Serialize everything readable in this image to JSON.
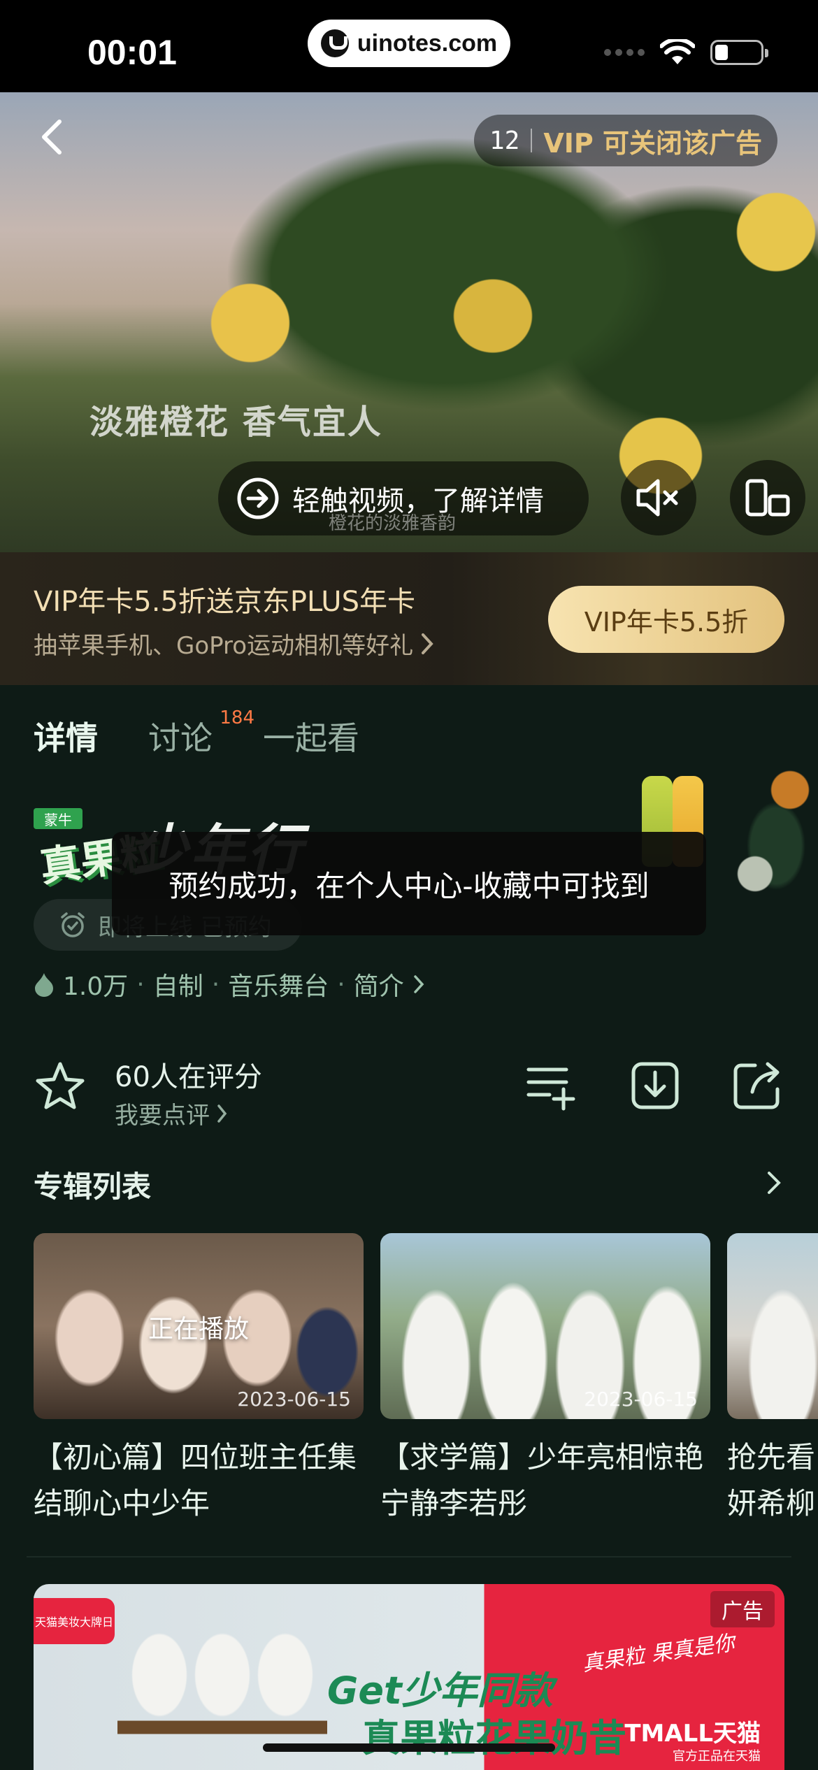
{
  "status_bar": {
    "time": "00:01",
    "url": "uinotes.com"
  },
  "video": {
    "ad_countdown": "12",
    "ad_vip_text": "VIP 可关闭该广告",
    "caption": "淡雅橙花 香气宜人",
    "subcaption": "橙花的淡雅香韵",
    "touch_text": "轻触视频，了解详情"
  },
  "vip_banner": {
    "title": "VIP年卡5.5折送京东PLUS年卡",
    "subtitle": "抽苹果手机、GoPro运动相机等好礼",
    "button": "VIP年卡5.5折"
  },
  "tabs": [
    {
      "label": "详情",
      "active": true
    },
    {
      "label": "讨论",
      "badge": "184"
    },
    {
      "label": "一起看"
    }
  ],
  "show": {
    "brand_badge": "蒙牛",
    "brand": "真果粒",
    "title_logo": "少年行",
    "reserve_text": "即将上线 已预约",
    "toast": "预约成功，在个人中心-收藏中可找到",
    "heat": "1.0万",
    "tags": [
      "自制",
      "音乐舞台",
      "简介"
    ]
  },
  "rating": {
    "title": "60人在评分",
    "sub": "我要点评"
  },
  "album": {
    "title": "专辑列表",
    "cards": [
      {
        "date": "2023-06-15",
        "status": "正在播放",
        "text": "【初心篇】四位班主任集结聊心中少年"
      },
      {
        "date": "2023-06-15",
        "text": "【求学篇】少年亮相惊艳宁静李若彤"
      },
      {
        "text": "抢先看妍希柳"
      }
    ]
  },
  "bottom_ad": {
    "tag": "天猫美妆大牌日",
    "slogan1": "Get少年同款",
    "slogan2": "真果粒花果奶昔",
    "label": "广告",
    "brand_script": "真果粒 果真是你",
    "tmall": "TMALL天猫",
    "tmall_sub": "官方正品在天猫"
  },
  "colors": {
    "background": "#0e1b16",
    "vip_gold": "#e8c47a",
    "accent_green": "#9fc3ad",
    "badge_orange": "#ff7a45"
  }
}
